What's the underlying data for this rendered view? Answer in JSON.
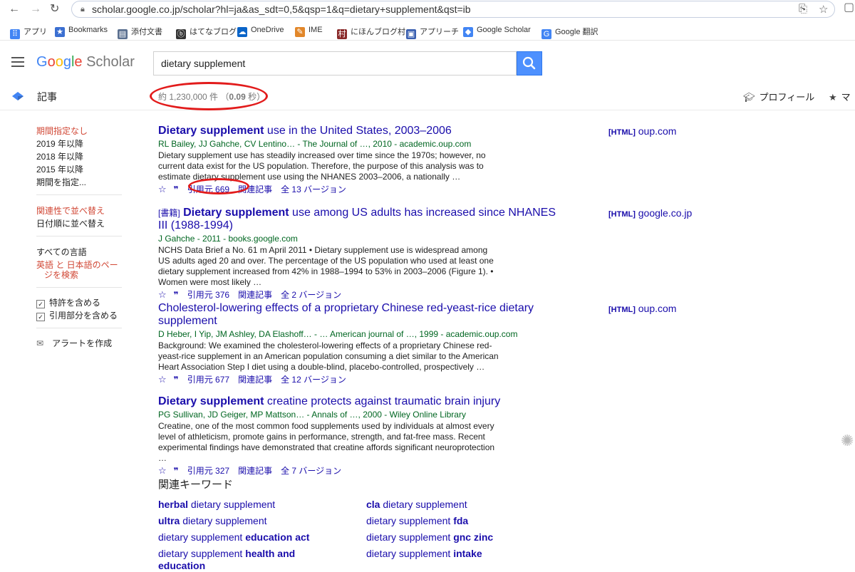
{
  "browser": {
    "url": "scholar.google.co.jp/scholar?hl=ja&as_sdt=0,5&qsp=1&q=dietary+supplement&qst=ib",
    "bookmarks": [
      {
        "label": "アプリ",
        "icon": "apps-grid-icon",
        "color": "#4285f4"
      },
      {
        "label": "Bookmarks",
        "icon": "star-icon",
        "color": "#3b6fd1"
      },
      {
        "label": "添付文書",
        "icon": "document-icon",
        "color": "#5a6f8f"
      },
      {
        "label": "はてなブログ",
        "icon": "hatena-icon",
        "color": "#333333"
      },
      {
        "label": "OneDrive",
        "icon": "cloud-icon",
        "color": "#0a64c8"
      },
      {
        "label": "IME",
        "icon": "ime-icon",
        "color": "#e2872a"
      },
      {
        "label": "にほんブログ村",
        "icon": "village-icon",
        "color": "#8a2a2a"
      },
      {
        "label": "アプリーチ",
        "icon": "appreach-icon",
        "color": "#3a5fb0"
      },
      {
        "label": "Google Scholar",
        "icon": "scholar-cap-icon",
        "color": "#4285f4"
      },
      {
        "label": "Google 翻訳",
        "icon": "translate-icon",
        "color": "#4285f4"
      }
    ]
  },
  "header": {
    "logo_google": [
      "G",
      "o",
      "o",
      "g",
      "l",
      "e"
    ],
    "logo_scholar": "Scholar",
    "search_value": "dietary supplement"
  },
  "subnav": {
    "articles": "記事",
    "count_prefix": "約 1,230,000 件 （",
    "count_time": "0.09",
    "count_suffix": " 秒）",
    "profile": "プロフィール",
    "my_library": "マ"
  },
  "sidebar": {
    "time": [
      "期間指定なし",
      "2019 年以降",
      "2018 年以降",
      "2015 年以降",
      "期間を指定..."
    ],
    "sort": [
      "関連性で並べ替え",
      "日付順に並べ替え"
    ],
    "lang_all": "すべての言語",
    "lang_ja_1": "英語 と 日本語のペー",
    "lang_ja_2": "ジを検索",
    "include_patents": "特許を含める",
    "include_citations": "引用部分を含める",
    "alert": "アラートを作成"
  },
  "results": [
    {
      "book_tag": "",
      "title_bold": "Dietary supplement",
      "title_rest": " use in the United States, 2003–2006",
      "meta": "RL Bailey, JJ Gahche, CV Lentino… - The Journal of …, 2010 - academic.oup.com",
      "snippet": "Dietary supplement use has steadily increased over time since the 1970s; however, no current data exist for the US population. Therefore, the purpose of this analysis was to estimate dietary supplement use using the NHANES 2003–2006, a nationally …",
      "cited": "引用元 669",
      "related": "関連記事",
      "versions": "全 13 バージョン",
      "side_tag": "[HTML]",
      "side_domain": "oup.com"
    },
    {
      "book_tag": "[書籍]",
      "title_bold": "Dietary supplement",
      "title_rest": " use among US adults has increased since NHANES III (1988-1994)",
      "meta": "J Gahche - 2011 - books.google.com",
      "snippet": "NCHS Data Brief a No. 61 m April 2011 • Dietary supplement use is widespread among US adults aged 20 and over. The percentage of the US population who used at least one dietary supplement increased from 42% in 1988–1994 to 53% in 2003–2006 (Figure 1). • Women were most likely …",
      "cited": "引用元 376",
      "related": "関連記事",
      "versions": "全 2 バージョン",
      "side_tag": "[HTML]",
      "side_domain": "google.co.jp"
    },
    {
      "book_tag": "",
      "title_bold": "",
      "title_rest": "Cholesterol-lowering effects of a proprietary Chinese red-yeast-rice dietary supplement",
      "meta": "D Heber, I Yip, JM Ashley, DA Elashoff… - … American journal of …, 1999 - academic.oup.com",
      "snippet": "Background: We examined the cholesterol-lowering effects of a proprietary Chinese red-yeast-rice supplement in an American population consuming a diet similar to the American Heart Association Step I diet using a double-blind, placebo-controlled, prospectively …",
      "cited": "引用元 677",
      "related": "関連記事",
      "versions": "全 12 バージョン",
      "side_tag": "[HTML]",
      "side_domain": "oup.com"
    },
    {
      "book_tag": "",
      "title_bold": "Dietary supplement",
      "title_rest": " creatine protects against traumatic brain injury",
      "meta": "PG Sullivan, JD Geiger, MP Mattson… - Annals of …, 2000 - Wiley Online Library",
      "snippet": "Creatine, one of the most common food supplements used by individuals at almost every level of athleticism, promote gains in performance, strength, and fat-free mass. Recent experimental findings have demonstrated that creatine affords significant neuroprotection …",
      "cited": "引用元 327",
      "related": "関連記事",
      "versions": "全 7 バージョン",
      "side_tag": "",
      "side_domain": ""
    }
  ],
  "related": {
    "heading": "関連キーワード",
    "left": [
      {
        "pre": "",
        "bold": "herbal",
        "post": " dietary supplement"
      },
      {
        "pre": "",
        "bold": "ultra",
        "post": " dietary supplement"
      },
      {
        "pre": "dietary supplement ",
        "bold": "education act",
        "post": ""
      },
      {
        "pre": "dietary supplement ",
        "bold": "health and education",
        "post": ""
      }
    ],
    "right": [
      {
        "pre": "",
        "bold": "cla",
        "post": " dietary supplement"
      },
      {
        "pre": "dietary supplement ",
        "bold": "fda",
        "post": ""
      },
      {
        "pre": "dietary supplement ",
        "bold": "gnc zinc",
        "post": ""
      },
      {
        "pre": "dietary supplement ",
        "bold": "intake",
        "post": ""
      }
    ]
  },
  "colors": {
    "link": "#1a0dab",
    "green": "#006621",
    "red_nav": "#d14836",
    "annotation": "#e21b1b",
    "search_button": "#4d90fe"
  }
}
